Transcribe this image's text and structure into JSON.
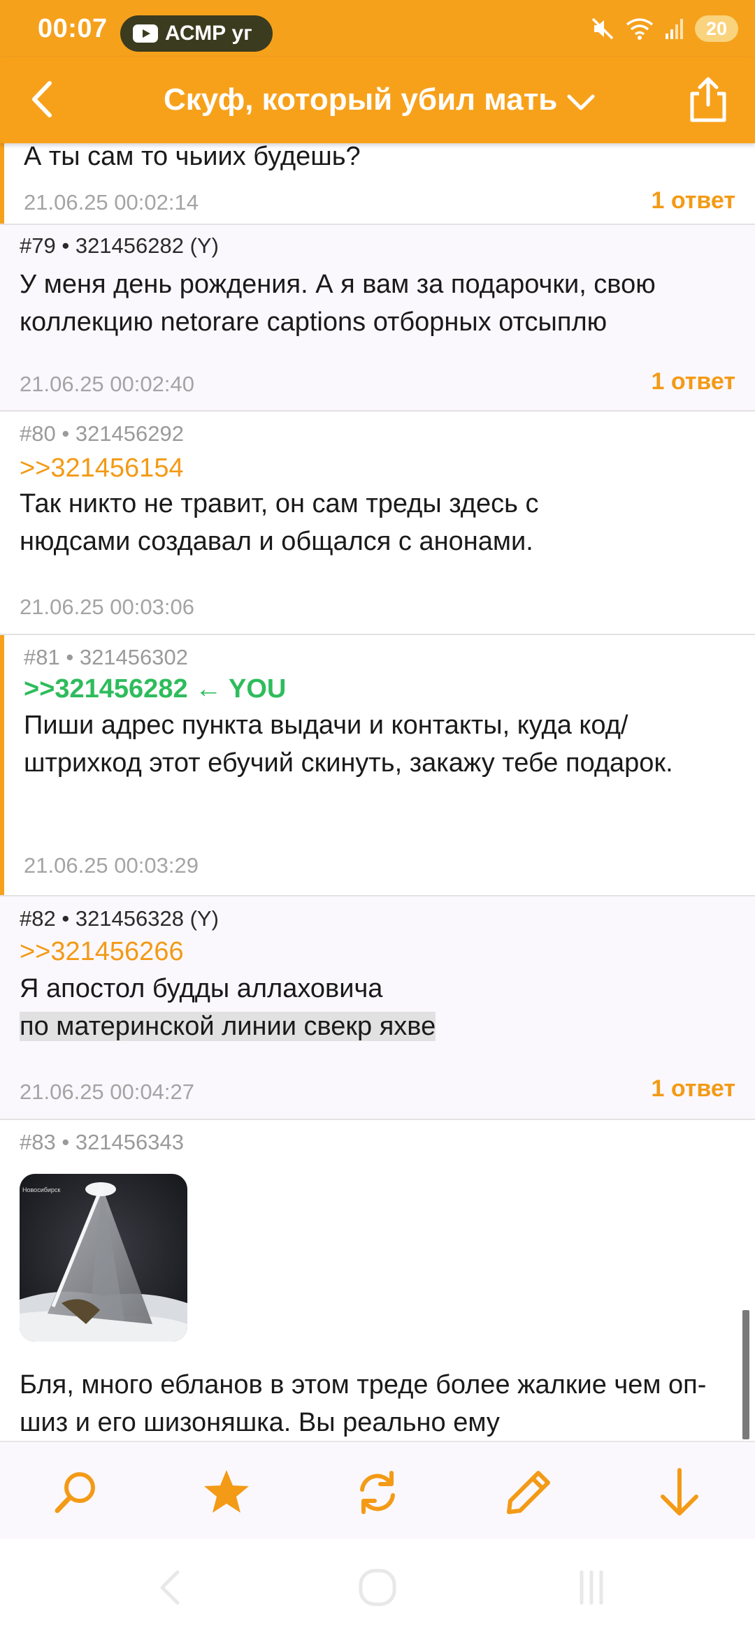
{
  "status_bar": {
    "time": "00:07",
    "media_text": "АСМР уг",
    "battery": "20",
    "icons": [
      "youtube-icon",
      "mute-icon",
      "wifi-icon",
      "signal-icon",
      "battery-icon"
    ]
  },
  "header": {
    "title": "Скуф, который убил мать",
    "back_icon": "chevron-left-icon",
    "dropdown_icon": "chevron-down-icon",
    "share_icon": "share-icon"
  },
  "posts": [
    {
      "text": "А ты сам то чьиих будешь?",
      "date": "21.06.25 00:02:14",
      "replies": "1 ответ"
    },
    {
      "number": "#79",
      "id": "321456282 (Y)",
      "text": "У меня день рождения. А я вам за подарочки, свою коллекцию netorare captions отборных отсыплю",
      "date": "21.06.25 00:02:40",
      "replies": "1 ответ"
    },
    {
      "number": "#80",
      "id": "321456292",
      "reply_to": ">>321456154",
      "text": "Так никто не травит, он сам треды здесь с нюдсами создавал и общался с анонами.",
      "date": "21.06.25 00:03:06"
    },
    {
      "number": "#81",
      "id": "321456302",
      "reply_to": ">>321456282",
      "you_marker": "← YOU",
      "text": "Пиши адрес пункта выдачи и контакты, куда код/штрихкод этот ебучий скинуть, закажу тебе подарок.",
      "date": "21.06.25 00:03:29"
    },
    {
      "number": "#82",
      "id": "321456328 (Y)",
      "reply_to": ">>321456266",
      "text_line1": "Я апостол будды аллаховича",
      "text_line2": "по материнской линии свекр яхве",
      "date": "21.06.25 00:04:27",
      "replies": "1 ответ"
    },
    {
      "number": "#83",
      "id": "321456343",
      "image_caption": "Новосибирск",
      "text": "Бля, много ебланов в этом треде более жалкие чем оп-шиз и его шизоняшка. Вы реально ему"
    }
  ],
  "separator": " • ",
  "toolbar": {
    "items": [
      "search-icon",
      "star-icon",
      "refresh-icon",
      "pencil-icon",
      "arrow-down-icon"
    ]
  },
  "colors": {
    "accent": "#f5a11c",
    "reply_link": "#f39a16",
    "you_link": "#2ebc5c",
    "post_tint": "#fbf8fd"
  }
}
